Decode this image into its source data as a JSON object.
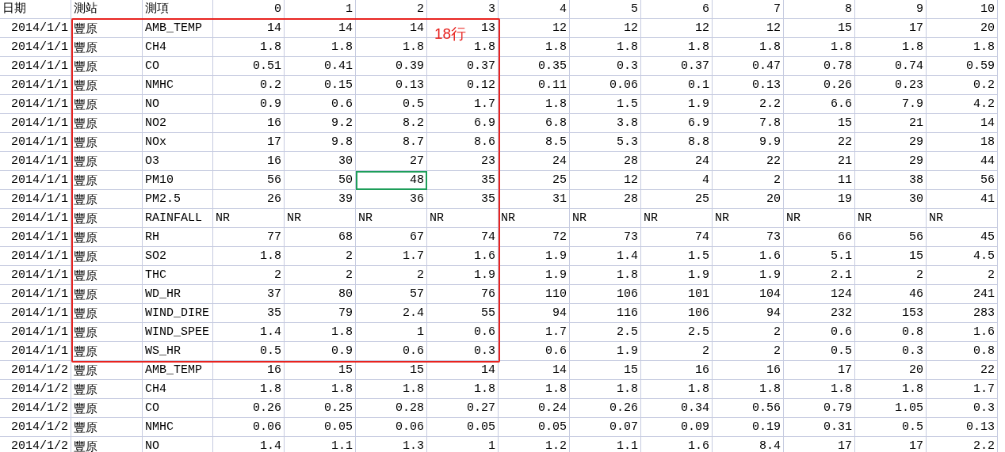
{
  "columns": [
    "日期",
    "測站",
    "測項",
    "0",
    "1",
    "2",
    "3",
    "4",
    "5",
    "6",
    "7",
    "8",
    "9",
    "10"
  ],
  "rows": [
    {
      "date": "2014/1/1",
      "station": "豐原",
      "item": "AMB_TEMP",
      "numeric": true,
      "values": [
        "14",
        "14",
        "14",
        "13",
        "12",
        "12",
        "12",
        "12",
        "15",
        "17",
        "20"
      ],
      "cell_selected": [
        false,
        false,
        false,
        false,
        false,
        false,
        false,
        false,
        false,
        false,
        false
      ]
    },
    {
      "date": "2014/1/1",
      "station": "豐原",
      "item": "CH4",
      "numeric": true,
      "values": [
        "1.8",
        "1.8",
        "1.8",
        "1.8",
        "1.8",
        "1.8",
        "1.8",
        "1.8",
        "1.8",
        "1.8",
        "1.8"
      ],
      "cell_selected": [
        false,
        false,
        false,
        false,
        false,
        false,
        false,
        false,
        false,
        false,
        false
      ]
    },
    {
      "date": "2014/1/1",
      "station": "豐原",
      "item": "CO",
      "numeric": true,
      "values": [
        "0.51",
        "0.41",
        "0.39",
        "0.37",
        "0.35",
        "0.3",
        "0.37",
        "0.47",
        "0.78",
        "0.74",
        "0.59"
      ],
      "cell_selected": [
        false,
        false,
        false,
        false,
        false,
        false,
        false,
        false,
        false,
        false,
        false
      ]
    },
    {
      "date": "2014/1/1",
      "station": "豐原",
      "item": "NMHC",
      "numeric": true,
      "values": [
        "0.2",
        "0.15",
        "0.13",
        "0.12",
        "0.11",
        "0.06",
        "0.1",
        "0.13",
        "0.26",
        "0.23",
        "0.2"
      ],
      "cell_selected": [
        false,
        false,
        false,
        false,
        false,
        false,
        false,
        false,
        false,
        false,
        false
      ]
    },
    {
      "date": "2014/1/1",
      "station": "豐原",
      "item": "NO",
      "numeric": true,
      "values": [
        "0.9",
        "0.6",
        "0.5",
        "1.7",
        "1.8",
        "1.5",
        "1.9",
        "2.2",
        "6.6",
        "7.9",
        "4.2"
      ],
      "cell_selected": [
        false,
        false,
        false,
        false,
        false,
        false,
        false,
        false,
        false,
        false,
        false
      ]
    },
    {
      "date": "2014/1/1",
      "station": "豐原",
      "item": "NO2",
      "numeric": true,
      "values": [
        "16",
        "9.2",
        "8.2",
        "6.9",
        "6.8",
        "3.8",
        "6.9",
        "7.8",
        "15",
        "21",
        "14"
      ],
      "cell_selected": [
        false,
        false,
        false,
        false,
        false,
        false,
        false,
        false,
        false,
        false,
        false
      ]
    },
    {
      "date": "2014/1/1",
      "station": "豐原",
      "item": "NOx",
      "numeric": true,
      "values": [
        "17",
        "9.8",
        "8.7",
        "8.6",
        "8.5",
        "5.3",
        "8.8",
        "9.9",
        "22",
        "29",
        "18"
      ],
      "cell_selected": [
        false,
        false,
        false,
        false,
        false,
        false,
        false,
        false,
        false,
        false,
        false
      ]
    },
    {
      "date": "2014/1/1",
      "station": "豐原",
      "item": "O3",
      "numeric": true,
      "values": [
        "16",
        "30",
        "27",
        "23",
        "24",
        "28",
        "24",
        "22",
        "21",
        "29",
        "44"
      ],
      "cell_selected": [
        false,
        false,
        false,
        false,
        false,
        false,
        false,
        false,
        false,
        false,
        false
      ]
    },
    {
      "date": "2014/1/1",
      "station": "豐原",
      "item": "PM10",
      "numeric": true,
      "values": [
        "56",
        "50",
        "48",
        "35",
        "25",
        "12",
        "4",
        "2",
        "11",
        "38",
        "56"
      ],
      "cell_selected": [
        false,
        false,
        true,
        false,
        false,
        false,
        false,
        false,
        false,
        false,
        false
      ]
    },
    {
      "date": "2014/1/1",
      "station": "豐原",
      "item": "PM2.5",
      "numeric": true,
      "values": [
        "26",
        "39",
        "36",
        "35",
        "31",
        "28",
        "25",
        "20",
        "19",
        "30",
        "41"
      ],
      "cell_selected": [
        false,
        false,
        false,
        false,
        false,
        false,
        false,
        false,
        false,
        false,
        false
      ]
    },
    {
      "date": "2014/1/1",
      "station": "豐原",
      "item": "RAINFALL",
      "numeric": false,
      "values": [
        "NR",
        "NR",
        "NR",
        "NR",
        "NR",
        "NR",
        "NR",
        "NR",
        "NR",
        "NR",
        "NR"
      ],
      "cell_selected": [
        false,
        false,
        false,
        false,
        false,
        false,
        false,
        false,
        false,
        false,
        false
      ]
    },
    {
      "date": "2014/1/1",
      "station": "豐原",
      "item": "RH",
      "numeric": true,
      "values": [
        "77",
        "68",
        "67",
        "74",
        "72",
        "73",
        "74",
        "73",
        "66",
        "56",
        "45"
      ],
      "cell_selected": [
        false,
        false,
        false,
        false,
        false,
        false,
        false,
        false,
        false,
        false,
        false
      ]
    },
    {
      "date": "2014/1/1",
      "station": "豐原",
      "item": "SO2",
      "numeric": true,
      "values": [
        "1.8",
        "2",
        "1.7",
        "1.6",
        "1.9",
        "1.4",
        "1.5",
        "1.6",
        "5.1",
        "15",
        "4.5"
      ],
      "cell_selected": [
        false,
        false,
        false,
        false,
        false,
        false,
        false,
        false,
        false,
        false,
        false
      ]
    },
    {
      "date": "2014/1/1",
      "station": "豐原",
      "item": "THC",
      "numeric": true,
      "values": [
        "2",
        "2",
        "2",
        "1.9",
        "1.9",
        "1.8",
        "1.9",
        "1.9",
        "2.1",
        "2",
        "2"
      ],
      "cell_selected": [
        false,
        false,
        false,
        false,
        false,
        false,
        false,
        false,
        false,
        false,
        false
      ]
    },
    {
      "date": "2014/1/1",
      "station": "豐原",
      "item": "WD_HR",
      "numeric": true,
      "values": [
        "37",
        "80",
        "57",
        "76",
        "110",
        "106",
        "101",
        "104",
        "124",
        "46",
        "241"
      ],
      "cell_selected": [
        false,
        false,
        false,
        false,
        false,
        false,
        false,
        false,
        false,
        false,
        false
      ]
    },
    {
      "date": "2014/1/1",
      "station": "豐原",
      "item": "WIND_DIRE",
      "numeric": true,
      "values": [
        "35",
        "79",
        "2.4",
        "55",
        "94",
        "116",
        "106",
        "94",
        "232",
        "153",
        "283"
      ],
      "cell_selected": [
        false,
        false,
        false,
        false,
        false,
        false,
        false,
        false,
        false,
        false,
        false
      ]
    },
    {
      "date": "2014/1/1",
      "station": "豐原",
      "item": "WIND_SPEE",
      "numeric": true,
      "values": [
        "1.4",
        "1.8",
        "1",
        "0.6",
        "1.7",
        "2.5",
        "2.5",
        "2",
        "0.6",
        "0.8",
        "1.6"
      ],
      "cell_selected": [
        false,
        false,
        false,
        false,
        false,
        false,
        false,
        false,
        false,
        false,
        false
      ]
    },
    {
      "date": "2014/1/1",
      "station": "豐原",
      "item": "WS_HR",
      "numeric": true,
      "values": [
        "0.5",
        "0.9",
        "0.6",
        "0.3",
        "0.6",
        "1.9",
        "2",
        "2",
        "0.5",
        "0.3",
        "0.8"
      ],
      "cell_selected": [
        false,
        false,
        false,
        false,
        false,
        false,
        false,
        false,
        false,
        false,
        false
      ]
    },
    {
      "date": "2014/1/2",
      "station": "豐原",
      "item": "AMB_TEMP",
      "numeric": true,
      "values": [
        "16",
        "15",
        "15",
        "14",
        "14",
        "15",
        "16",
        "16",
        "17",
        "20",
        "22"
      ],
      "cell_selected": [
        false,
        false,
        false,
        false,
        false,
        false,
        false,
        false,
        false,
        false,
        false
      ]
    },
    {
      "date": "2014/1/2",
      "station": "豐原",
      "item": "CH4",
      "numeric": true,
      "values": [
        "1.8",
        "1.8",
        "1.8",
        "1.8",
        "1.8",
        "1.8",
        "1.8",
        "1.8",
        "1.8",
        "1.8",
        "1.7"
      ],
      "cell_selected": [
        false,
        false,
        false,
        false,
        false,
        false,
        false,
        false,
        false,
        false,
        false
      ]
    },
    {
      "date": "2014/1/2",
      "station": "豐原",
      "item": "CO",
      "numeric": true,
      "values": [
        "0.26",
        "0.25",
        "0.28",
        "0.27",
        "0.24",
        "0.26",
        "0.34",
        "0.56",
        "0.79",
        "1.05",
        "0.3"
      ],
      "cell_selected": [
        false,
        false,
        false,
        false,
        false,
        false,
        false,
        false,
        false,
        false,
        false
      ]
    },
    {
      "date": "2014/1/2",
      "station": "豐原",
      "item": "NMHC",
      "numeric": true,
      "values": [
        "0.06",
        "0.05",
        "0.06",
        "0.05",
        "0.05",
        "0.07",
        "0.09",
        "0.19",
        "0.31",
        "0.5",
        "0.13"
      ],
      "cell_selected": [
        false,
        false,
        false,
        false,
        false,
        false,
        false,
        false,
        false,
        false,
        false
      ]
    },
    {
      "date": "2014/1/2",
      "station": "豐原",
      "item": "NO",
      "numeric": true,
      "values": [
        "1.4",
        "1.1",
        "1.3",
        "1",
        "1.2",
        "1.1",
        "1.6",
        "8.4",
        "17",
        "17",
        "2.2"
      ],
      "cell_selected": [
        false,
        false,
        false,
        false,
        false,
        false,
        false,
        false,
        false,
        false,
        false
      ]
    }
  ],
  "annotation": {
    "label": "18行"
  }
}
